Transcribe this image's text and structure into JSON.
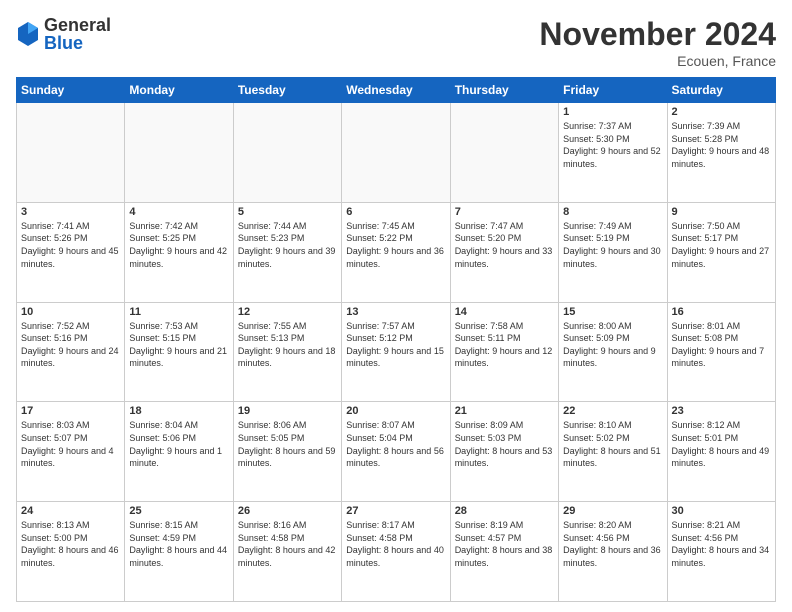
{
  "logo": {
    "general": "General",
    "blue": "Blue"
  },
  "header": {
    "month": "November 2024",
    "location": "Ecouen, France"
  },
  "weekdays": [
    "Sunday",
    "Monday",
    "Tuesday",
    "Wednesday",
    "Thursday",
    "Friday",
    "Saturday"
  ],
  "weeks": [
    [
      {
        "day": "",
        "info": ""
      },
      {
        "day": "",
        "info": ""
      },
      {
        "day": "",
        "info": ""
      },
      {
        "day": "",
        "info": ""
      },
      {
        "day": "",
        "info": ""
      },
      {
        "day": "1",
        "info": "Sunrise: 7:37 AM\nSunset: 5:30 PM\nDaylight: 9 hours and 52 minutes."
      },
      {
        "day": "2",
        "info": "Sunrise: 7:39 AM\nSunset: 5:28 PM\nDaylight: 9 hours and 48 minutes."
      }
    ],
    [
      {
        "day": "3",
        "info": "Sunrise: 7:41 AM\nSunset: 5:26 PM\nDaylight: 9 hours and 45 minutes."
      },
      {
        "day": "4",
        "info": "Sunrise: 7:42 AM\nSunset: 5:25 PM\nDaylight: 9 hours and 42 minutes."
      },
      {
        "day": "5",
        "info": "Sunrise: 7:44 AM\nSunset: 5:23 PM\nDaylight: 9 hours and 39 minutes."
      },
      {
        "day": "6",
        "info": "Sunrise: 7:45 AM\nSunset: 5:22 PM\nDaylight: 9 hours and 36 minutes."
      },
      {
        "day": "7",
        "info": "Sunrise: 7:47 AM\nSunset: 5:20 PM\nDaylight: 9 hours and 33 minutes."
      },
      {
        "day": "8",
        "info": "Sunrise: 7:49 AM\nSunset: 5:19 PM\nDaylight: 9 hours and 30 minutes."
      },
      {
        "day": "9",
        "info": "Sunrise: 7:50 AM\nSunset: 5:17 PM\nDaylight: 9 hours and 27 minutes."
      }
    ],
    [
      {
        "day": "10",
        "info": "Sunrise: 7:52 AM\nSunset: 5:16 PM\nDaylight: 9 hours and 24 minutes."
      },
      {
        "day": "11",
        "info": "Sunrise: 7:53 AM\nSunset: 5:15 PM\nDaylight: 9 hours and 21 minutes."
      },
      {
        "day": "12",
        "info": "Sunrise: 7:55 AM\nSunset: 5:13 PM\nDaylight: 9 hours and 18 minutes."
      },
      {
        "day": "13",
        "info": "Sunrise: 7:57 AM\nSunset: 5:12 PM\nDaylight: 9 hours and 15 minutes."
      },
      {
        "day": "14",
        "info": "Sunrise: 7:58 AM\nSunset: 5:11 PM\nDaylight: 9 hours and 12 minutes."
      },
      {
        "day": "15",
        "info": "Sunrise: 8:00 AM\nSunset: 5:09 PM\nDaylight: 9 hours and 9 minutes."
      },
      {
        "day": "16",
        "info": "Sunrise: 8:01 AM\nSunset: 5:08 PM\nDaylight: 9 hours and 7 minutes."
      }
    ],
    [
      {
        "day": "17",
        "info": "Sunrise: 8:03 AM\nSunset: 5:07 PM\nDaylight: 9 hours and 4 minutes."
      },
      {
        "day": "18",
        "info": "Sunrise: 8:04 AM\nSunset: 5:06 PM\nDaylight: 9 hours and 1 minute."
      },
      {
        "day": "19",
        "info": "Sunrise: 8:06 AM\nSunset: 5:05 PM\nDaylight: 8 hours and 59 minutes."
      },
      {
        "day": "20",
        "info": "Sunrise: 8:07 AM\nSunset: 5:04 PM\nDaylight: 8 hours and 56 minutes."
      },
      {
        "day": "21",
        "info": "Sunrise: 8:09 AM\nSunset: 5:03 PM\nDaylight: 8 hours and 53 minutes."
      },
      {
        "day": "22",
        "info": "Sunrise: 8:10 AM\nSunset: 5:02 PM\nDaylight: 8 hours and 51 minutes."
      },
      {
        "day": "23",
        "info": "Sunrise: 8:12 AM\nSunset: 5:01 PM\nDaylight: 8 hours and 49 minutes."
      }
    ],
    [
      {
        "day": "24",
        "info": "Sunrise: 8:13 AM\nSunset: 5:00 PM\nDaylight: 8 hours and 46 minutes."
      },
      {
        "day": "25",
        "info": "Sunrise: 8:15 AM\nSunset: 4:59 PM\nDaylight: 8 hours and 44 minutes."
      },
      {
        "day": "26",
        "info": "Sunrise: 8:16 AM\nSunset: 4:58 PM\nDaylight: 8 hours and 42 minutes."
      },
      {
        "day": "27",
        "info": "Sunrise: 8:17 AM\nSunset: 4:58 PM\nDaylight: 8 hours and 40 minutes."
      },
      {
        "day": "28",
        "info": "Sunrise: 8:19 AM\nSunset: 4:57 PM\nDaylight: 8 hours and 38 minutes."
      },
      {
        "day": "29",
        "info": "Sunrise: 8:20 AM\nSunset: 4:56 PM\nDaylight: 8 hours and 36 minutes."
      },
      {
        "day": "30",
        "info": "Sunrise: 8:21 AM\nSunset: 4:56 PM\nDaylight: 8 hours and 34 minutes."
      }
    ]
  ]
}
